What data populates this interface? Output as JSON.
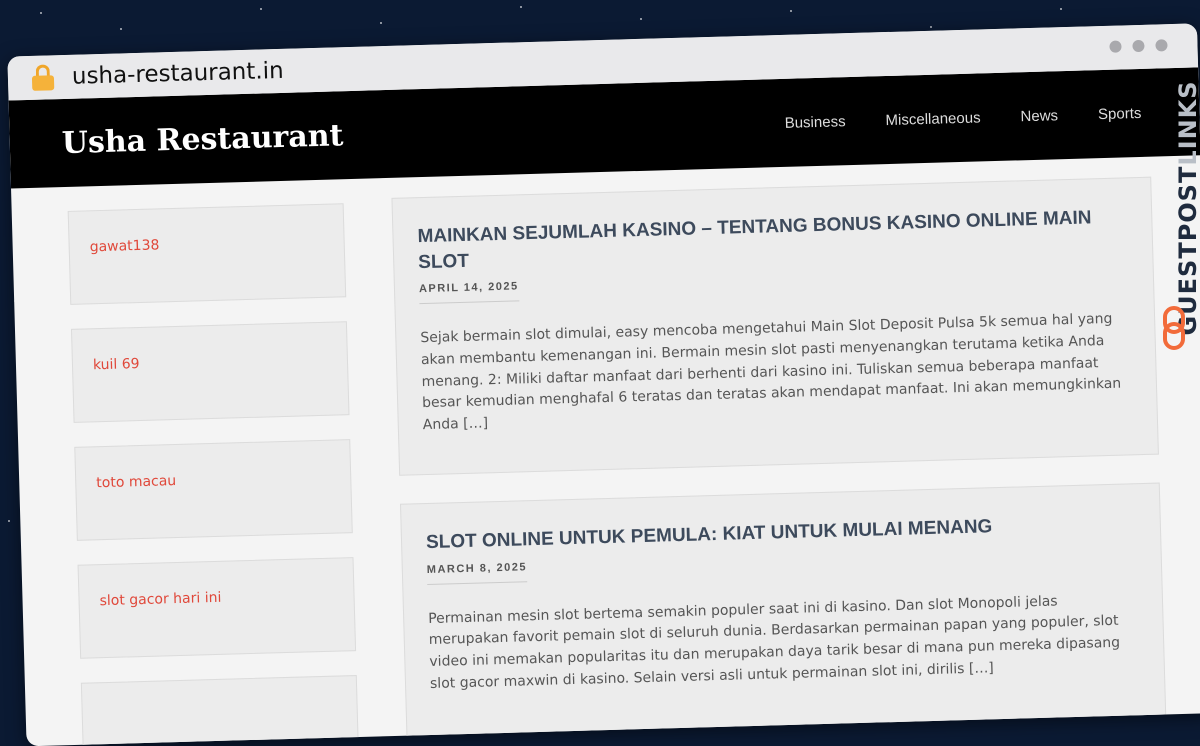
{
  "browser": {
    "url": "usha-restaurant.in"
  },
  "site": {
    "title": "Usha Restaurant"
  },
  "nav": [
    "Business",
    "Miscellaneous",
    "News",
    "Sports"
  ],
  "sidebar": {
    "items": [
      "gawat138",
      "kuil 69",
      "toto macau",
      "slot gacor hari ini"
    ]
  },
  "posts": [
    {
      "title": "MAINKAN SEJUMLAH KASINO – TENTANG BONUS KASINO ONLINE MAIN SLOT",
      "date": "APRIL 14, 2025",
      "excerpt": "Sejak bermain slot dimulai, easy mencoba mengetahui Main Slot Deposit Pulsa 5k semua hal yang akan membantu kemenangan ini. Bermain mesin slot pasti menyenangkan terutama ketika Anda menang. 2: Miliki daftar manfaat dari berhenti dari kasino ini. Tuliskan semua beberapa manfaat besar kemudian menghafal 6 teratas dan teratas akan mendapat manfaat. Ini akan memungkinkan Anda […]"
    },
    {
      "title": "SLOT ONLINE UNTUK PEMULA: KIAT UNTUK MULAI MENANG",
      "date": "MARCH 8, 2025",
      "excerpt": "Permainan mesin slot bertema semakin populer saat ini di kasino. Dan slot Monopoli jelas merupakan favorit pemain slot di seluruh dunia. Berdasarkan permainan papan yang populer, slot video ini memakan popularitas itu dan merupakan daya tarik besar di mana pun mereka dipasang slot gacor maxwin di kasino. Selain versi asli untuk permainan slot ini, dirilis […]"
    }
  ],
  "watermark": {
    "part1": "GUESTPOST",
    "part2": "LINKS"
  },
  "colors": {
    "accent": "#e0483a",
    "header_bg": "#000000",
    "watermark_orange": "#f26b3a"
  },
  "icons": {
    "lock": "lock-icon",
    "watermark_logo": "link-chain-icon"
  }
}
